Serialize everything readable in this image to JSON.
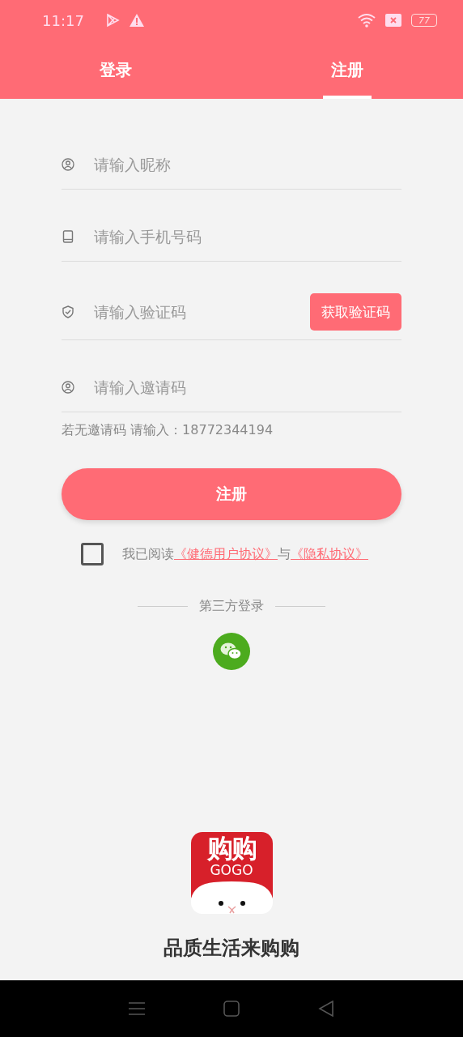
{
  "status_bar": {
    "time": "11:17",
    "battery": "77"
  },
  "tabs": [
    {
      "label": "登录",
      "selected": false
    },
    {
      "label": "注册",
      "selected": true
    }
  ],
  "fields": [
    {
      "kind": "user",
      "placeholder": "请输入昵称"
    },
    {
      "kind": "phone",
      "placeholder": "请输入手机号码"
    },
    {
      "kind": "shield",
      "placeholder": "请输入验证码",
      "button": "获取验证码"
    },
    {
      "kind": "user",
      "placeholder": "请输入邀请码"
    }
  ],
  "hint": "若无邀请码 请输入：18772344194",
  "register_button": "注册",
  "agreement": {
    "checked": false,
    "prefix": "我已阅读",
    "links": [
      "《健德用户协议》",
      "《隐私协议》"
    ],
    "connector": "与"
  },
  "third_party": {
    "label": "第三方登录"
  },
  "logo": {
    "title": "购购",
    "subtitle": "GOGO"
  },
  "slogan": "品质生活来购购"
}
